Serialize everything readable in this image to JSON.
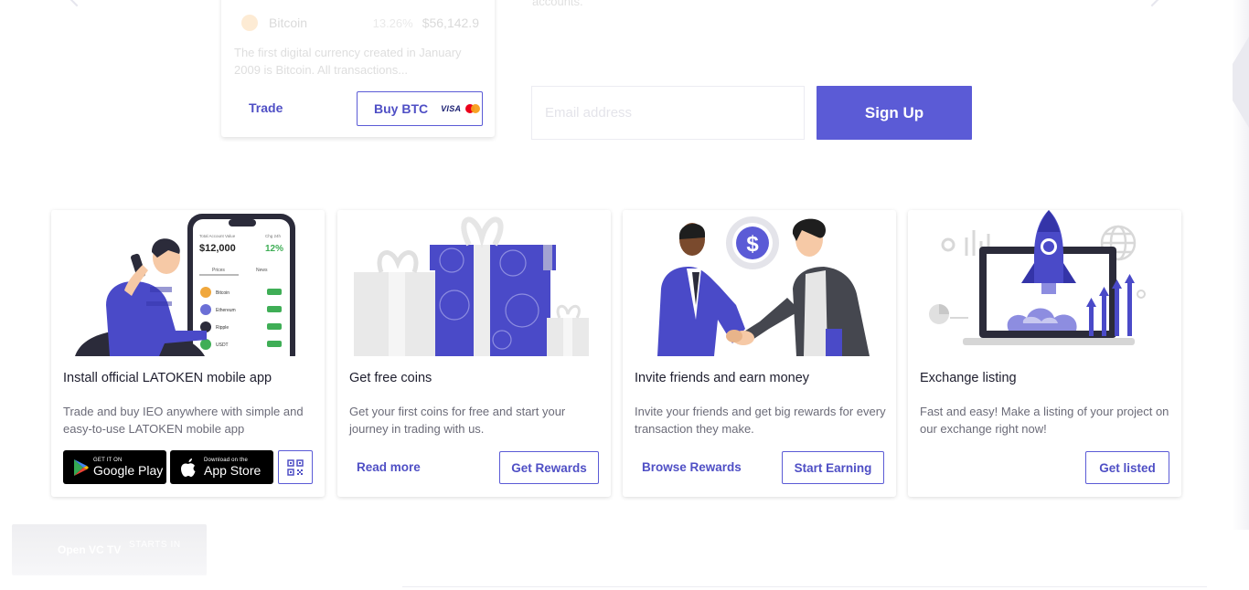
{
  "crypto_card": {
    "coin_name": "Bitcoin",
    "change": "13.26%",
    "price": "$56,142.9",
    "description": "The first digital currency created in January 2009 is Bitcoin. All transactions...",
    "trade_label": "Trade",
    "buy_label": "Buy BTC",
    "visa_label": "VISA"
  },
  "signup": {
    "intro_text": "accounts.",
    "email_placeholder": "Email address",
    "button_label": "Sign Up"
  },
  "cards": [
    {
      "title": "Install official LATOKEN mobile app",
      "description": "Trade and buy IEO anywhere with simple and easy-to-use LATOKEN mobile app",
      "google_play": {
        "small": "GET IT ON",
        "big": "Google Play"
      },
      "app_store": {
        "small": "Download on the",
        "big": "App Store"
      },
      "phone": {
        "account_label": "Total Account Value",
        "period_label": "Chg 24h",
        "balance": "$12,000",
        "change": "12%",
        "tab_prices": "Prices",
        "tab_news": "News",
        "coins": [
          "Bitcoin",
          "Ethereum",
          "Ripple",
          "USDT"
        ]
      }
    },
    {
      "title": "Get free coins",
      "description": "Get your first coins for free and start your journey in trading with us.",
      "link": "Read more",
      "button": "Get Rewards"
    },
    {
      "title": "Invite friends and earn money",
      "description": "Invite your friends and get big rewards for every transaction they make.",
      "link": "Browse Rewards",
      "button": "Start Earning"
    },
    {
      "title": "Exchange listing",
      "description": "Fast and easy! Make a listing of your project on our exchange right now!",
      "button": "Get listed"
    }
  ],
  "vc_widget": {
    "label": "Open VC TV",
    "starts": "STARTS IN"
  },
  "colors": {
    "accent": "#5b5bd6",
    "link": "#4f4fc5",
    "illustration_purple": "#4a4ac8",
    "illustration_gray": "#e8e8e8"
  },
  "icons": [
    "bitcoin-icon",
    "mastercard-icon",
    "google-play-icon",
    "apple-icon",
    "qr-code-icon",
    "dollar-icon",
    "rocket-icon",
    "gear-icon",
    "globe-icon",
    "bar-chart-icon",
    "pie-chart-icon"
  ]
}
